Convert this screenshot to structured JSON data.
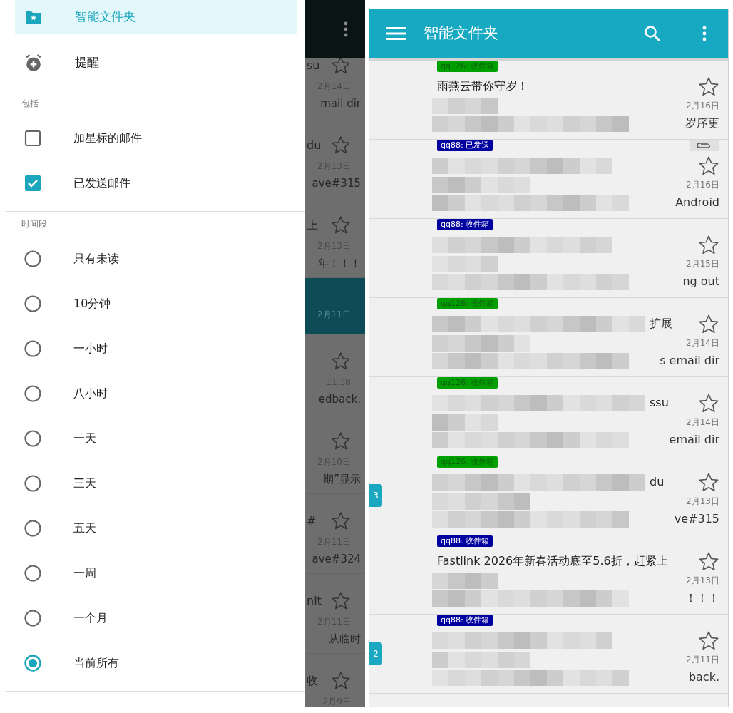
{
  "left_screen": {
    "drawer": {
      "items": [
        {
          "kind": "folder",
          "label": "智能文件夹",
          "selected": true
        },
        {
          "kind": "reminder",
          "label": "提醒",
          "selected": false
        }
      ],
      "sections": [
        {
          "title": "包括",
          "options": [
            {
              "kind": "checkbox",
              "label": "加星标的邮件",
              "checked": false
            },
            {
              "kind": "checkbox",
              "label": "已发送邮件",
              "checked": true
            }
          ]
        },
        {
          "title": "时间段",
          "options": [
            {
              "kind": "radio",
              "label": "只有未读",
              "selected": false
            },
            {
              "kind": "radio",
              "label": "10分钟",
              "selected": false
            },
            {
              "kind": "radio",
              "label": "一小时",
              "selected": false
            },
            {
              "kind": "radio",
              "label": "八小时",
              "selected": false
            },
            {
              "kind": "radio",
              "label": "一天",
              "selected": false
            },
            {
              "kind": "radio",
              "label": "三天",
              "selected": false
            },
            {
              "kind": "radio",
              "label": "五天",
              "selected": false
            },
            {
              "kind": "radio",
              "label": "一周",
              "selected": false
            },
            {
              "kind": "radio",
              "label": "一个月",
              "selected": false
            },
            {
              "kind": "radio",
              "label": "当前所有",
              "selected": true
            }
          ]
        }
      ]
    },
    "background_list": {
      "rows": [
        {
          "top": "su",
          "date": "2月14日",
          "bottom": "mail dir",
          "selected": false
        },
        {
          "top": "du",
          "date": "2月13日",
          "bottom": "ave#315",
          "selected": false
        },
        {
          "top": "上",
          "date": "2月13日",
          "bottom": "年！！！",
          "selected": false
        },
        {
          "date": "2月11日",
          "selected": true
        },
        {
          "date": "11:38",
          "bottom": "edback.",
          "selected": false
        },
        {
          "date": "2月10日",
          "bottom": "期”显示",
          "selected": false
        },
        {
          "top": "#",
          "date": "2月11日",
          "bottom": "ave#324",
          "selected": false
        },
        {
          "top": "nlt",
          "date": "2月11日",
          "bottom": "从临时",
          "selected": false
        },
        {
          "top": "收",
          "date": "2月9日",
          "selected": false
        }
      ]
    }
  },
  "right_screen": {
    "app_bar": {
      "title": "智能文件夹"
    },
    "messages": [
      {
        "tag": {
          "text": "qq126: 收件箱",
          "color": "#00a000"
        },
        "subject": "雨燕云带你守岁！",
        "date": "2月16日",
        "bottom_fragment": "岁序更"
      },
      {
        "tag": {
          "text": "qq88: 已发送",
          "color": "#0000a0"
        },
        "attachment": true,
        "date": "2月16日",
        "bottom_fragment": "Android"
      },
      {
        "tag": {
          "text": "qq88: 收件箱",
          "color": "#0000a0"
        },
        "date": "2月15日",
        "bottom_fragment": "ng out"
      },
      {
        "tag": {
          "text": "qq126: 收件箱",
          "color": "#00a000"
        },
        "top_fragment": "扩展",
        "date": "2月14日",
        "bottom_fragment": "s email dir"
      },
      {
        "tag": {
          "text": "qq126: 收件箱",
          "color": "#00a000"
        },
        "top_fragment": "ssu",
        "date": "2月14日",
        "bottom_fragment": "email dir"
      },
      {
        "tag": {
          "text": "qq126: 收件箱",
          "color": "#00a000"
        },
        "unread_count": "3",
        "top_fragment": "du",
        "date": "2月13日",
        "bottom_fragment": "ve#315"
      },
      {
        "tag": {
          "text": "qq88: 收件箱",
          "color": "#0000a0"
        },
        "subject": "Fastlink 2026年新春活动底至5.6折，赶紧上",
        "date": "2月13日",
        "bottom_fragment": "！！！"
      },
      {
        "tag": {
          "text": "qq88: 收件箱",
          "color": "#0000a0"
        },
        "unread_count": "2",
        "date": "2月11日",
        "bottom_fragment": "back."
      }
    ]
  }
}
